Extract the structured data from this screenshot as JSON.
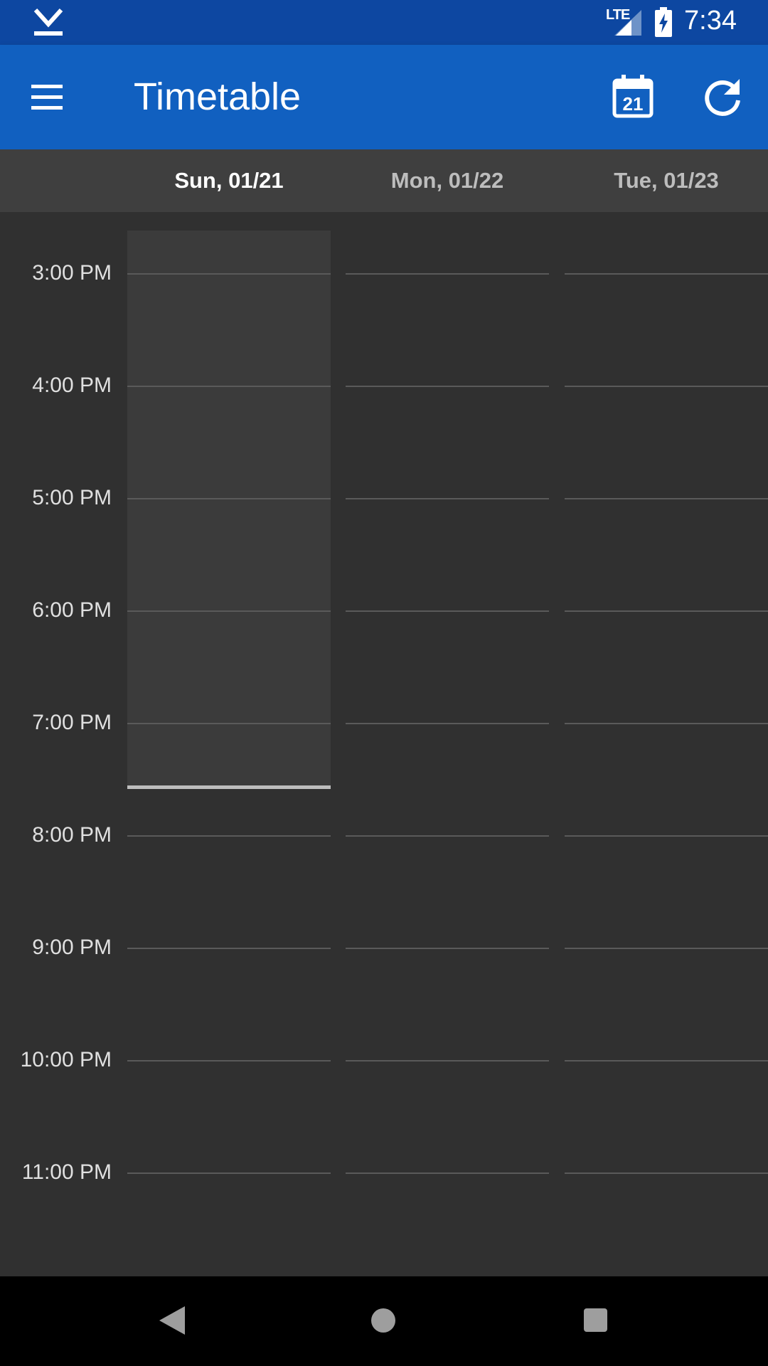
{
  "status_bar": {
    "network": "LTE",
    "time": "7:34",
    "icons": [
      "download-icon",
      "signal-icon",
      "battery-charging-icon"
    ]
  },
  "app_bar": {
    "title": "Timetable",
    "actions": [
      "menu-icon",
      "calendar-today-icon",
      "refresh-icon"
    ],
    "calendar_day": "21",
    "color": "#1160C0"
  },
  "days": [
    {
      "label": "Sun, 01/21",
      "active": true
    },
    {
      "label": "Mon, 01/22",
      "active": false
    },
    {
      "label": "Tue, 01/23",
      "active": false
    }
  ],
  "hours": [
    "3:00 PM",
    "4:00 PM",
    "5:00 PM",
    "6:00 PM",
    "7:00 PM",
    "8:00 PM",
    "9:00 PM",
    "10:00 PM",
    "11:00 PM"
  ],
  "nav_bar": {
    "buttons": [
      "back-icon",
      "home-icon",
      "recents-icon"
    ]
  }
}
